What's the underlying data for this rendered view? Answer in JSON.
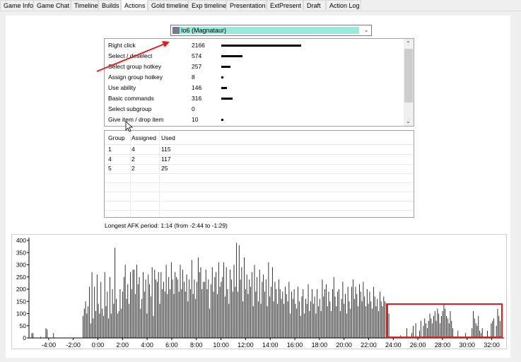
{
  "tabs": [
    "Game Info",
    "Game Chat",
    "Timeline",
    "Builds",
    "Actions",
    "Gold timeline",
    "Exp timeline",
    "Presentation",
    "ExtPresent",
    "Draft",
    "Action Log"
  ],
  "active_tab": "Actions",
  "player_select": {
    "value": "Io6 (Magnataur)"
  },
  "actions": [
    {
      "name": "Right click",
      "count": "2166",
      "value": 2166
    },
    {
      "name": "Select / deselect",
      "count": "574",
      "value": 574
    },
    {
      "name": "Select group hotkey",
      "count": "257",
      "value": 257
    },
    {
      "name": "Assign group hotkey",
      "count": "8",
      "value": 8
    },
    {
      "name": "Use ability",
      "count": "146",
      "value": 146
    },
    {
      "name": "Basic commands",
      "count": "316",
      "value": 316
    },
    {
      "name": "Select subgroup",
      "count": "0",
      "value": 0
    },
    {
      "name": "Give item / drop item",
      "count": "10",
      "value": 10
    }
  ],
  "groups": {
    "headers": [
      "Group",
      "Assigned",
      "Used"
    ],
    "rows": [
      [
        "1",
        "4",
        "115"
      ],
      [
        "4",
        "2",
        "117"
      ],
      [
        "5",
        "2",
        "25"
      ]
    ]
  },
  "afk_text": "Longest AFK period: 1:14 (from -2:44 to -1:29)",
  "colors": {
    "selection": "#99eadb",
    "highlight": "#d92020",
    "bar": "#000000"
  },
  "chart_data": {
    "type": "bar",
    "title": "",
    "xlabel": "",
    "ylabel": "",
    "ylim": [
      0,
      400
    ],
    "yticks": [
      "0",
      "50",
      "100",
      "150",
      "200",
      "250",
      "300",
      "350",
      "400"
    ],
    "xticks": [
      "-4:00",
      "-2:00",
      "0:00",
      "2:00",
      "4:00",
      "6:00",
      "8:00",
      "10:00",
      "12:00",
      "14:00",
      "16:00",
      "18:00",
      "20:00",
      "22:00",
      "24:00",
      "26:00",
      "28:00",
      "30:00",
      "32:00"
    ],
    "x_start_min": -5.6,
    "x_end_min": 33.0,
    "values": [
      20,
      20,
      0,
      0,
      0,
      0,
      0,
      5,
      0,
      0,
      0,
      40,
      35,
      0,
      0,
      0,
      0,
      20,
      0,
      0,
      0,
      0,
      0,
      0,
      0,
      0,
      0,
      0,
      0,
      0,
      0,
      0,
      0,
      0,
      0,
      0,
      0,
      0,
      0,
      0,
      90,
      120,
      150,
      100,
      130,
      210,
      60,
      270,
      80,
      210,
      110,
      260,
      140,
      100,
      230,
      120,
      90,
      270,
      130,
      190,
      80,
      250,
      100,
      200,
      140,
      370,
      160,
      100,
      110,
      200,
      120,
      190,
      250,
      300,
      160,
      220,
      140,
      270,
      200,
      280,
      280,
      180,
      300,
      220,
      250,
      120,
      160,
      270,
      190,
      240,
      100,
      260,
      220,
      170,
      290,
      90,
      280,
      240,
      230,
      270,
      140,
      270,
      200,
      230,
      190,
      300,
      180,
      250,
      200,
      310,
      240,
      180,
      270,
      250,
      240,
      190,
      300,
      200,
      280,
      230,
      190,
      260,
      150,
      240,
      200,
      320,
      180,
      240,
      160,
      230,
      330,
      270,
      290,
      200,
      230,
      230,
      280,
      200,
      240,
      120,
      220,
      290,
      190,
      250,
      270,
      180,
      310,
      210,
      230,
      250,
      310,
      170,
      290,
      200,
      140,
      280,
      240,
      190,
      300,
      210,
      390,
      190,
      380,
      240,
      290,
      150,
      330,
      200,
      260,
      180,
      240,
      210,
      270,
      130,
      300,
      190,
      250,
      150,
      280,
      140,
      230,
      260,
      190,
      240,
      130,
      310,
      170,
      210,
      290,
      150,
      230,
      200,
      140,
      240,
      200,
      160,
      190,
      140,
      210,
      180,
      150,
      230,
      100,
      190,
      160,
      200,
      140,
      120,
      210,
      150,
      90,
      170,
      200,
      100,
      160,
      140,
      220,
      110,
      150,
      200,
      140,
      170,
      100,
      200,
      130,
      160,
      110,
      240,
      170,
      200,
      220,
      130,
      190,
      150,
      110,
      200,
      250,
      170,
      130,
      190,
      200,
      110,
      160,
      230,
      140,
      180,
      100,
      210,
      150,
      120,
      210,
      240,
      160,
      210,
      180,
      130,
      220,
      190,
      150,
      230,
      170,
      130,
      200,
      140,
      190,
      150,
      120,
      210,
      170,
      130,
      160,
      110,
      190,
      150,
      130,
      170,
      150,
      120,
      140,
      100,
      0,
      0,
      0,
      0,
      0,
      0,
      0,
      5,
      10,
      0,
      0,
      0,
      0,
      40,
      0,
      0,
      0,
      20,
      50,
      0,
      60,
      0,
      0,
      30,
      70,
      0,
      50,
      80,
      60,
      40,
      70,
      100,
      80,
      60,
      90,
      110,
      70,
      120,
      100,
      60,
      90,
      110,
      140,
      120,
      90,
      80,
      60,
      110,
      70,
      40,
      0,
      0,
      0,
      30,
      0,
      0,
      0,
      0,
      0,
      20,
      0,
      0,
      0,
      0,
      40,
      110,
      80,
      60,
      50,
      90,
      30,
      20,
      40,
      0,
      0,
      0,
      30,
      0,
      0,
      60,
      70,
      80,
      0,
      50,
      120,
      90,
      70,
      0,
      0
    ]
  }
}
